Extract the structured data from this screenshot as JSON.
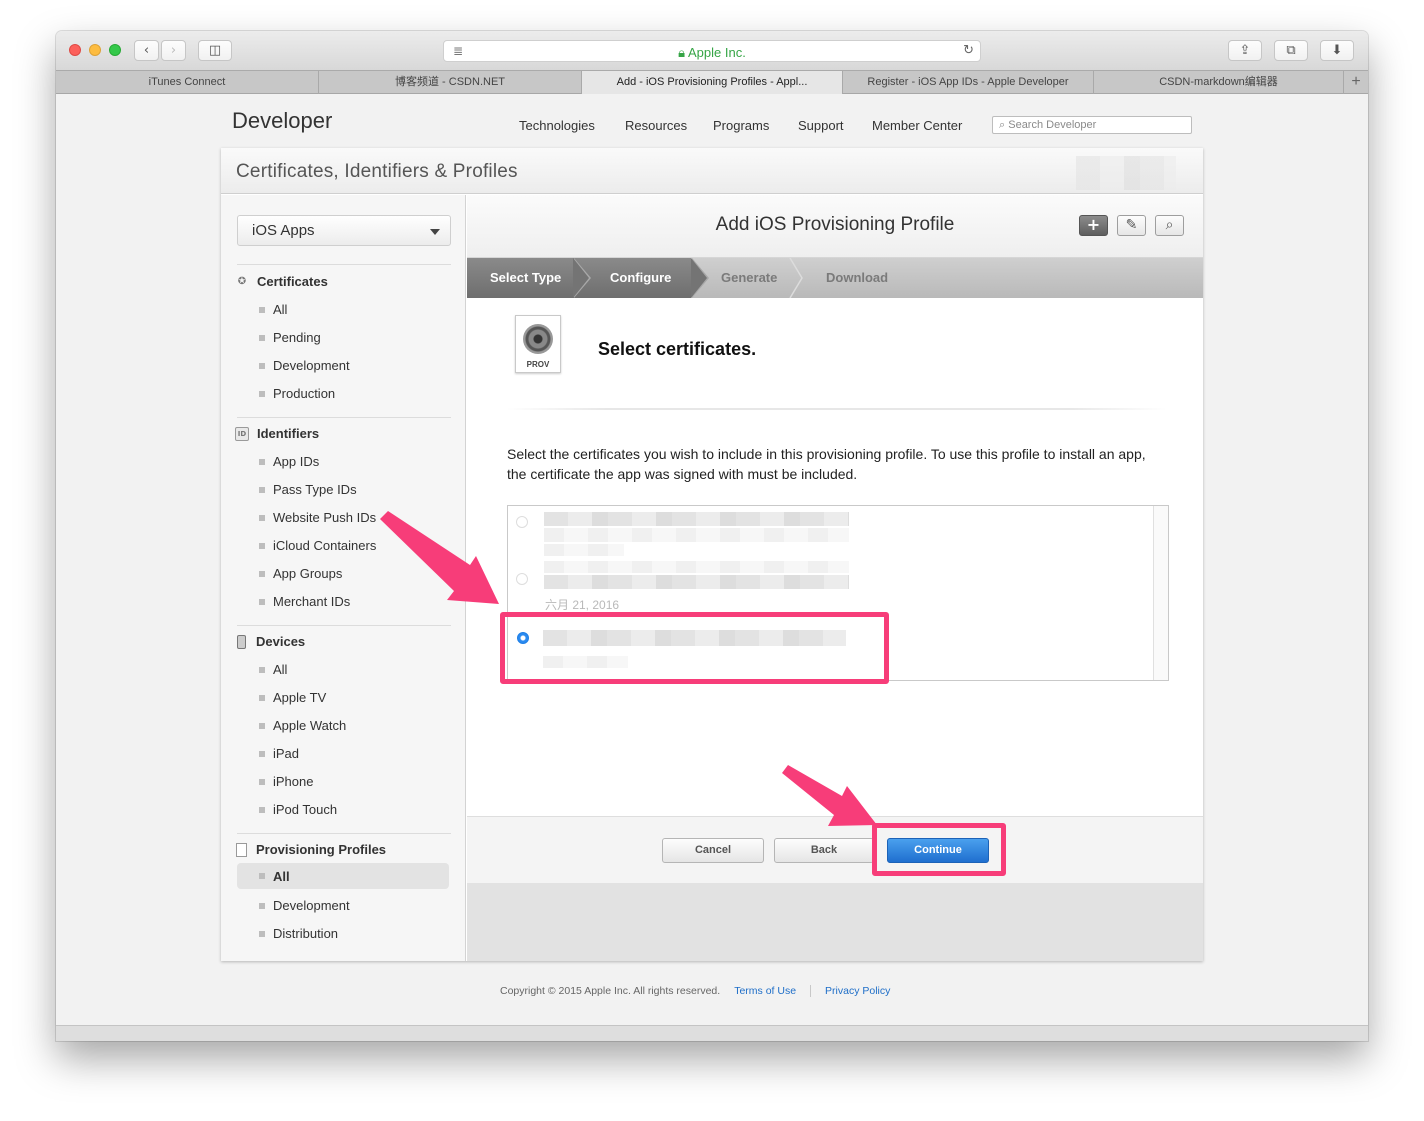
{
  "browser": {
    "address": "Apple Inc.",
    "tabs": [
      {
        "label": "iTunes Connect",
        "active": false
      },
      {
        "label": "博客频道 - CSDN.NET",
        "active": false
      },
      {
        "label": "Add - iOS Provisioning Profiles - Appl...",
        "active": true
      },
      {
        "label": "Register - iOS App IDs - Apple Developer",
        "active": false
      },
      {
        "label": "CSDN-markdown编辑器",
        "active": false
      }
    ],
    "new_tab": "+"
  },
  "site": {
    "brand": "Developer",
    "nav": [
      "Technologies",
      "Resources",
      "Programs",
      "Support",
      "Member Center"
    ],
    "search_placeholder": "Search Developer"
  },
  "card": {
    "title": "Certificates, Identifiers & Profiles"
  },
  "sidebar": {
    "platform": "iOS Apps",
    "sections": [
      {
        "title": "Certificates",
        "icon": "certificate-icon",
        "items": [
          "All",
          "Pending",
          "Development",
          "Production"
        ]
      },
      {
        "title": "Identifiers",
        "icon": "id-icon",
        "icon_text": "ID",
        "items": [
          "App IDs",
          "Pass Type IDs",
          "Website Push IDs",
          "iCloud Containers",
          "App Groups",
          "Merchant IDs"
        ]
      },
      {
        "title": "Devices",
        "icon": "device-icon",
        "items": [
          "All",
          "Apple TV",
          "Apple Watch",
          "iPad",
          "iPhone",
          "iPod Touch"
        ]
      },
      {
        "title": "Provisioning Profiles",
        "icon": "document-icon",
        "items": [
          "All",
          "Development",
          "Distribution"
        ],
        "active_item": "All"
      }
    ]
  },
  "main": {
    "title": "Add iOS Provisioning Profile",
    "steps": [
      {
        "label": "Select Type",
        "state": "done"
      },
      {
        "label": "Configure",
        "state": "done"
      },
      {
        "label": "Generate",
        "state": "todo"
      },
      {
        "label": "Download",
        "state": "todo"
      }
    ],
    "icon_label": "PROV",
    "heading": "Select certificates.",
    "description": "Select the certificates you wish to include in this provisioning profile. To use this profile to install an app, the certificate the app was signed with must be included.",
    "certificates": [
      {
        "selected": false,
        "date": ""
      },
      {
        "selected": false,
        "date": "六月 21, 2016"
      },
      {
        "selected": true,
        "date": ""
      }
    ],
    "buttons": {
      "cancel": "Cancel",
      "back": "Back",
      "continue": "Continue"
    }
  },
  "footer": {
    "copyright": "Copyright © 2015 Apple Inc. All rights reserved.",
    "terms": "Terms of Use",
    "privacy": "Privacy Policy"
  },
  "colors": {
    "annotation": "#f73d79",
    "primary_button": "#2a7fdc",
    "link": "#1e6ec8"
  }
}
